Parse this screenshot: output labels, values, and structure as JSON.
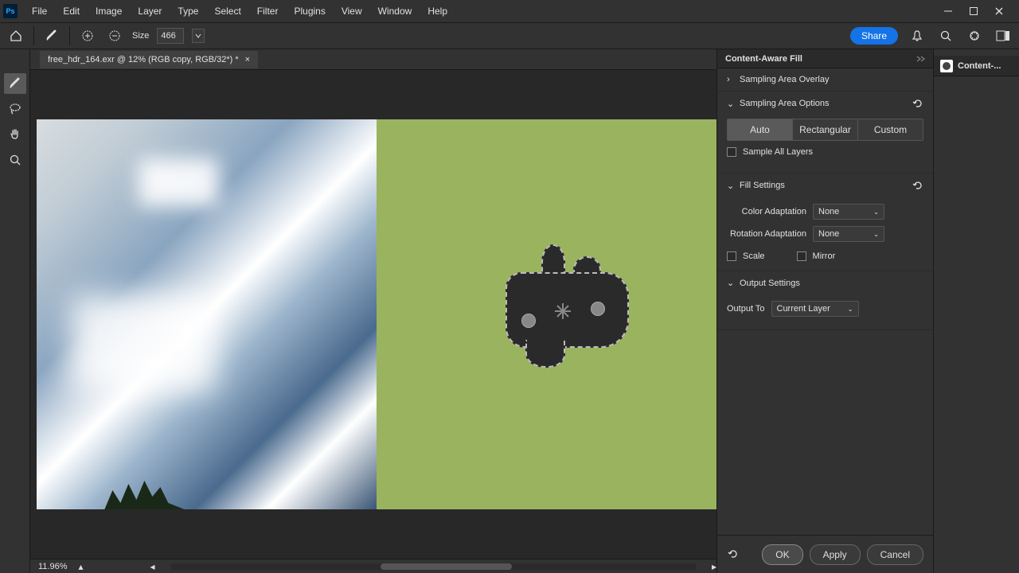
{
  "menubar": {
    "items": [
      "File",
      "Edit",
      "Image",
      "Layer",
      "Type",
      "Select",
      "Filter",
      "Plugins",
      "View",
      "Window",
      "Help"
    ]
  },
  "optionsbar": {
    "size_label": "Size",
    "size_value": "466",
    "share_label": "Share"
  },
  "document": {
    "tab_title": "free_hdr_164.exr @ 12% (RGB copy, RGB/32*) *",
    "zoom": "11.96%"
  },
  "caf": {
    "title": "Content-Aware Fill",
    "sections": {
      "overlay": {
        "title": "Sampling Area Overlay"
      },
      "options": {
        "title": "Sampling Area Options",
        "segs": [
          "Auto",
          "Rectangular",
          "Custom"
        ],
        "active_seg": 0,
        "sample_all_layers": "Sample All Layers"
      },
      "fill": {
        "title": "Fill Settings",
        "color_adapt_label": "Color Adaptation",
        "color_adapt_value": "None",
        "rotation_adapt_label": "Rotation Adaptation",
        "rotation_adapt_value": "None",
        "scale_label": "Scale",
        "mirror_label": "Mirror"
      },
      "output": {
        "title": "Output Settings",
        "output_to_label": "Output To",
        "output_to_value": "Current Layer"
      }
    },
    "buttons": {
      "ok": "OK",
      "apply": "Apply",
      "cancel": "Cancel"
    }
  },
  "right_strip": {
    "tab": "Content-..."
  }
}
